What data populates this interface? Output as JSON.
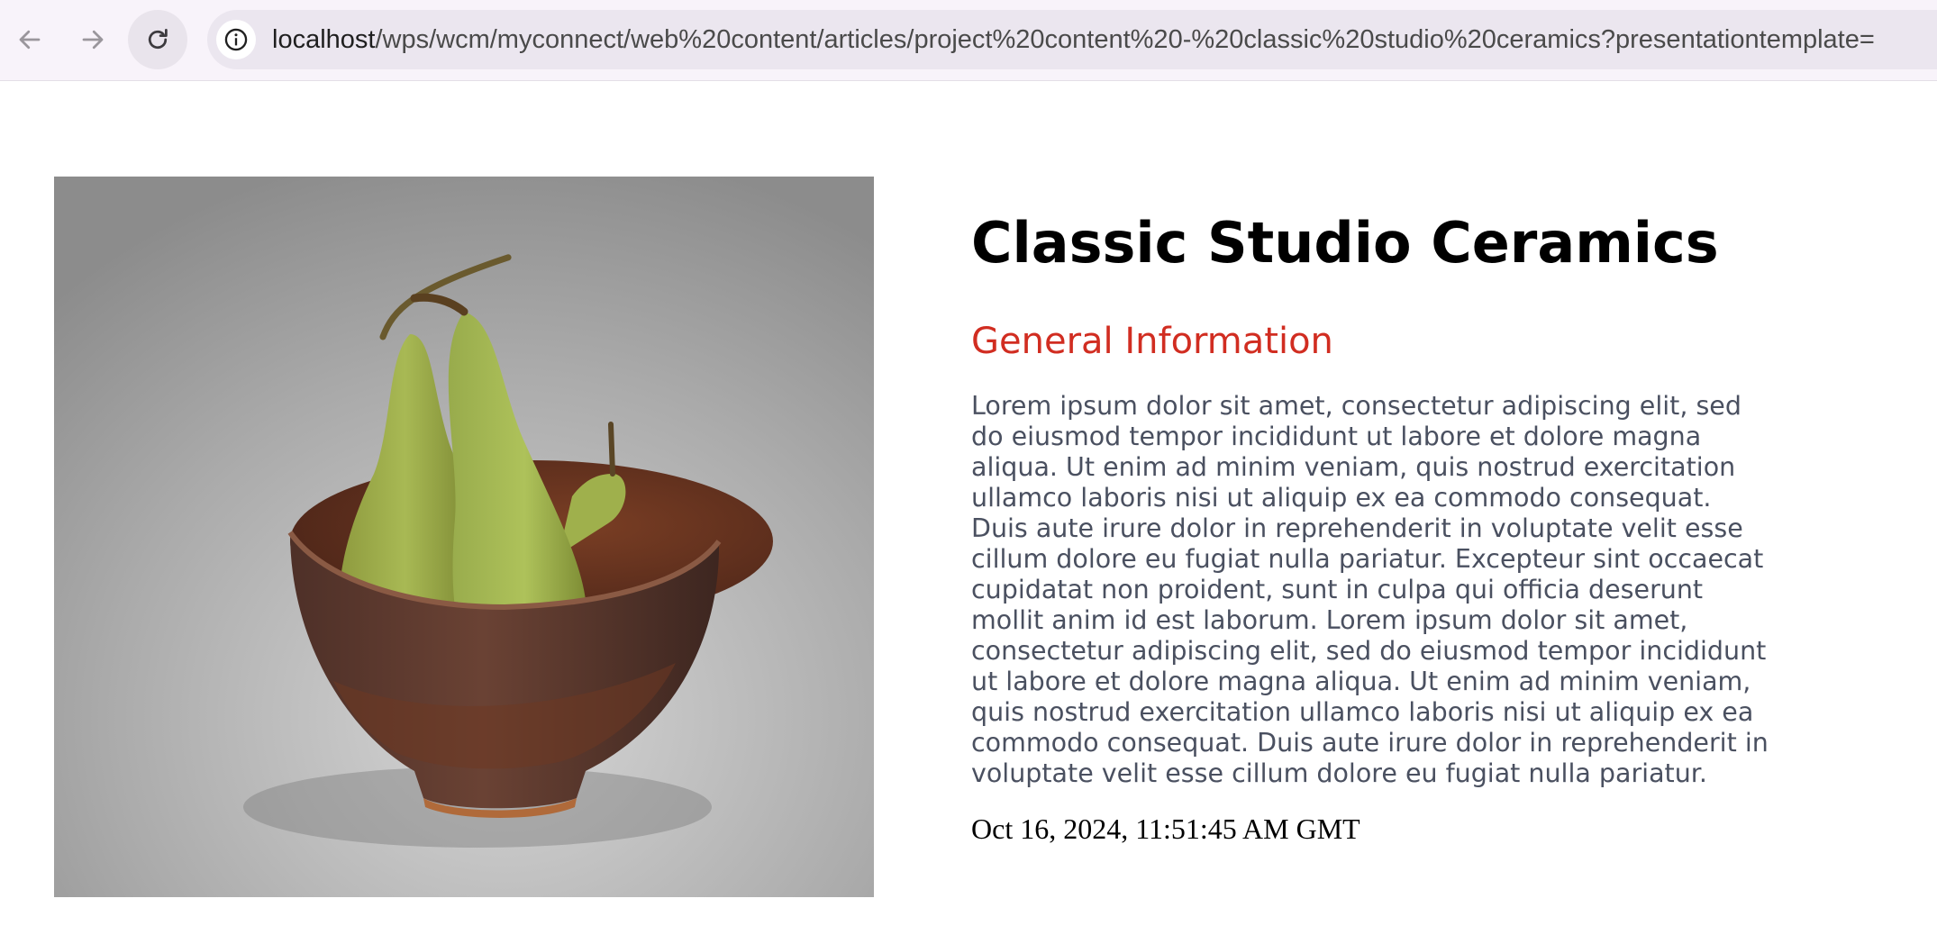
{
  "browser": {
    "url_host": "localhost",
    "url_path": "/wps/wcm/myconnect/web%20content/articles/project%20content%20-%20classic%20studio%20ceramics?presentationtemplate=",
    "icons": {
      "back": "arrow-left-icon",
      "forward": "arrow-right-icon",
      "reload": "reload-icon",
      "site_info": "info-icon"
    }
  },
  "article": {
    "title": "Classic Studio Ceramics",
    "section_heading": "General Information",
    "body": "Lorem ipsum dolor sit amet, consectetur adipiscing elit, sed do eiusmod tempor incididunt ut labore et dolore magna aliqua. Ut enim ad minim veniam, quis nostrud exercitation ullamco laboris nisi ut aliquip ex ea commodo consequat. Duis aute irure dolor in reprehenderit in voluptate velit esse cillum dolore eu fugiat nulla pariatur. Excepteur sint occaecat cupidatat non proident, sunt in culpa qui officia deserunt mollit anim id est laborum. Lorem ipsum dolor sit amet, consectetur adipiscing elit, sed do eiusmod tempor incididunt ut labore et dolore magna aliqua. Ut enim ad minim veniam, quis nostrud exercitation ullamco laboris nisi ut aliquip ex ea commodo consequat. Duis aute irure dolor in reprehenderit in voluptate velit esse cillum dolore eu fugiat nulla pariatur.",
    "date": "Oct 16, 2024, 11:51:45 AM GMT"
  },
  "colors": {
    "heading_accent": "#d12d21",
    "body_text": "#4a5060",
    "toolbar_bg": "#f8f3fa"
  }
}
